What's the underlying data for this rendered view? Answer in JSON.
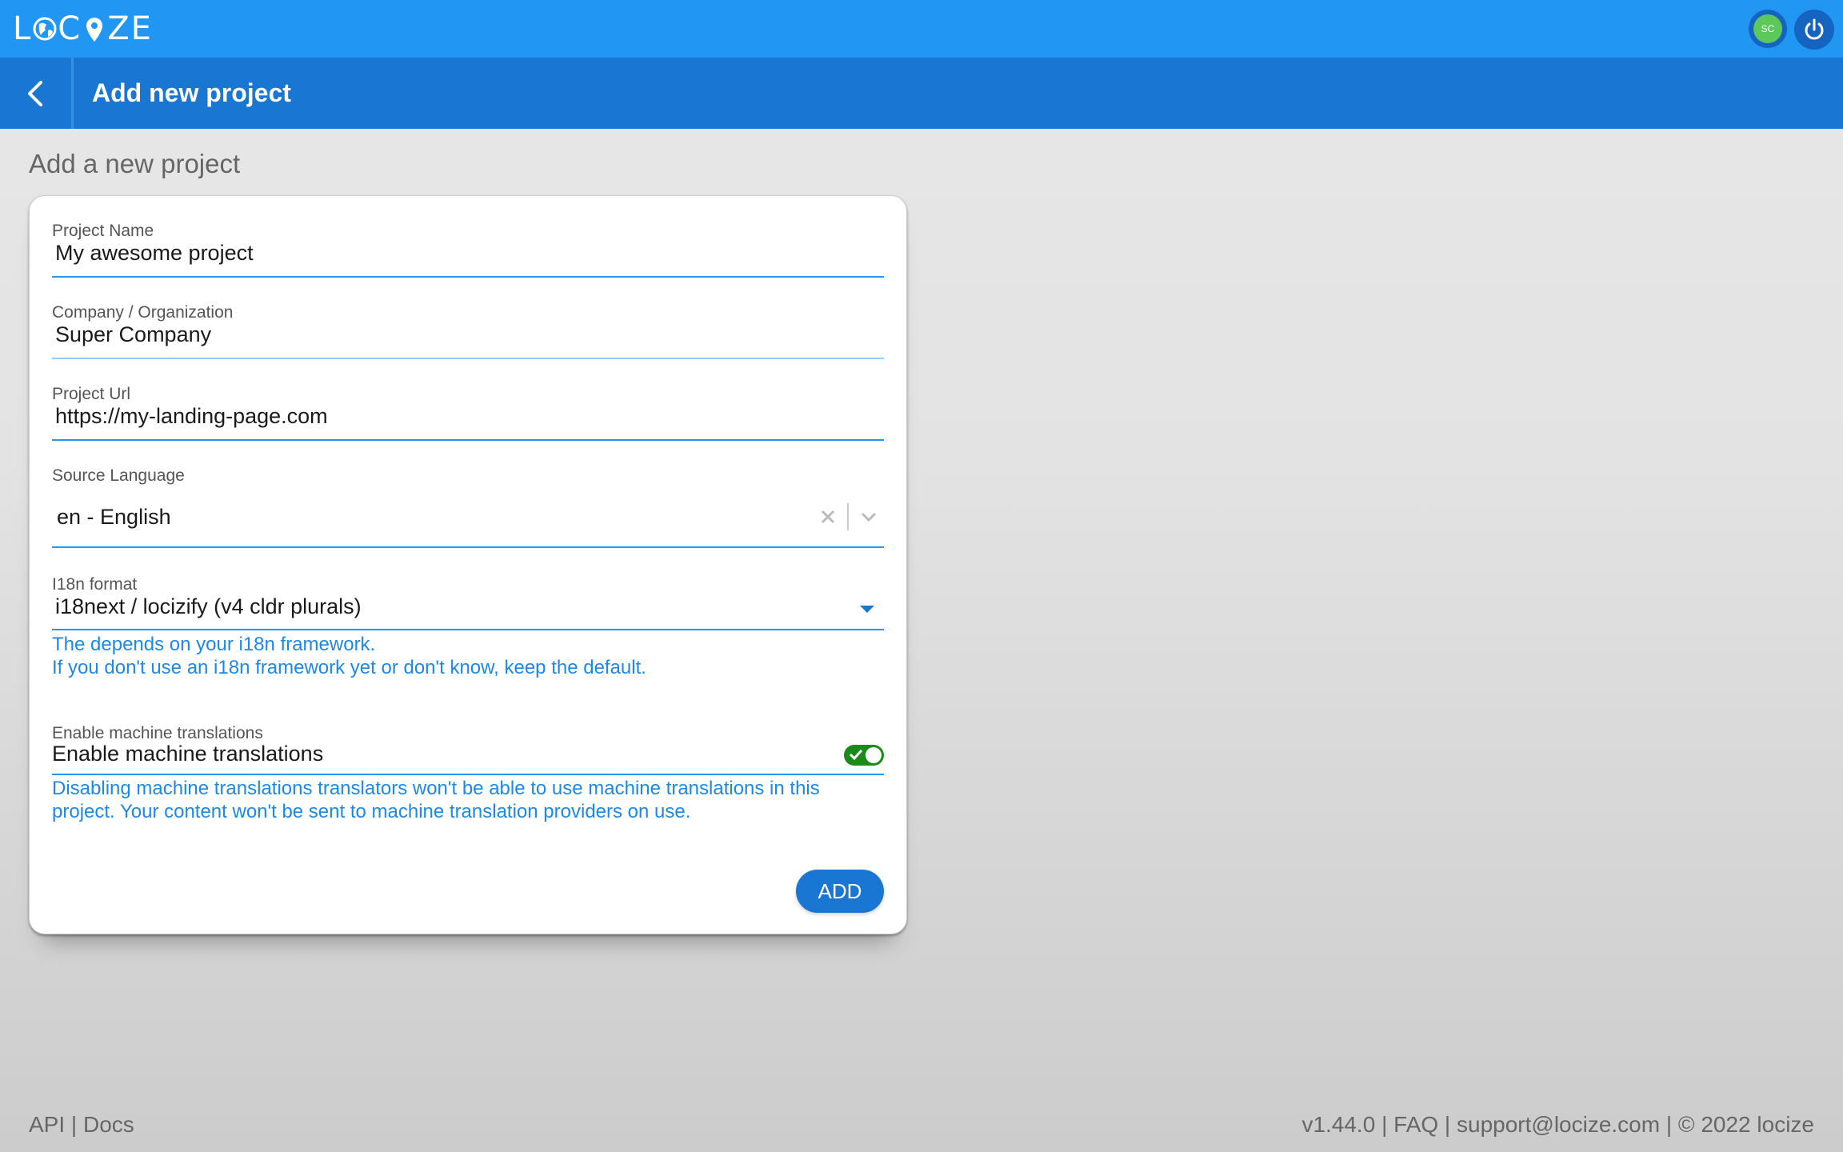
{
  "app": {
    "logo_text": "LOCIZE",
    "avatar_initials": "SC"
  },
  "header": {
    "title": "Add new project"
  },
  "main": {
    "section_title": "Add a new project"
  },
  "form": {
    "project_name": {
      "label": "Project Name",
      "value": "My awesome project"
    },
    "company": {
      "label": "Company / Organization",
      "value": "Super Company"
    },
    "project_url": {
      "label": "Project Url",
      "value": "https://my-landing-page.com"
    },
    "source_language": {
      "label": "Source Language",
      "value": "en - English"
    },
    "i18n_format": {
      "label": "I18n format",
      "value": "i18next / locizify (v4 cldr plurals)",
      "helper_line1": "The depends on your i18n framework.",
      "helper_line2": "If you don't use an i18n framework yet or don't know, keep the default."
    },
    "machine_translations": {
      "label": "Enable machine translations",
      "toggle_label": "Enable machine translations",
      "enabled": true,
      "helper_line1": "Disabling machine translations translators won't be able to use machine translations in this",
      "helper_line2": "project. Your content won't be sent to machine translation providers on use."
    },
    "add_button": "ADD"
  },
  "footer": {
    "api": "API",
    "sep": " | ",
    "docs": "Docs",
    "version": "v1.44.0",
    "faq": "FAQ",
    "support": "support@locize.com",
    "copyright": "© 2022 locize"
  },
  "colors": {
    "topbar": "#2196f3",
    "headerbar": "#1976d2",
    "accent": "#1e88e5",
    "toggle_on": "#1b8a1b",
    "avatar": "#5cc85c"
  }
}
